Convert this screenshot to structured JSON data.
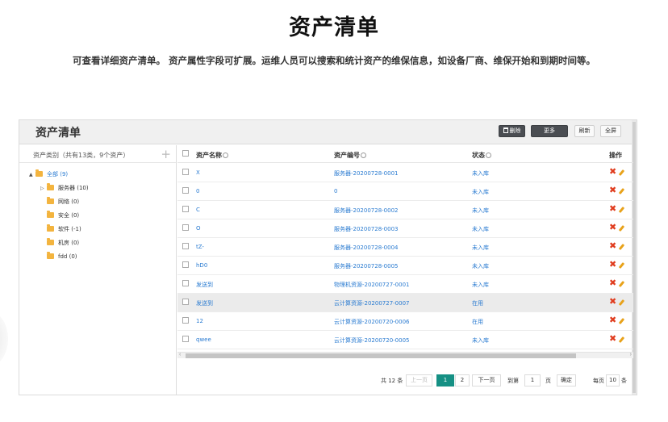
{
  "page": {
    "title": "资产清单",
    "subtitle": "可查看详细资产清单。 资产属性字段可扩展。运维人员可以搜索和统计资产的维保信息，如设备厂商、维保开始和到期时间等。"
  },
  "app": {
    "title": "资产清单",
    "toolbar": {
      "delete_label": "删除",
      "more_label": "更多",
      "refresh_label": "刷新",
      "fullscreen_label": "全屏"
    }
  },
  "sidebar": {
    "title": "资产类别（共有13类，9个资产）",
    "add_icon": "plus-icon",
    "root": {
      "label": "全部",
      "count": "(9)"
    },
    "items": [
      {
        "label": "服务器",
        "count": "(10)",
        "expandable": true
      },
      {
        "label": "网络",
        "count": "(0)"
      },
      {
        "label": "安全",
        "count": "(0)"
      },
      {
        "label": "软件",
        "count": "(-1)"
      },
      {
        "label": "机房",
        "count": "(0)"
      },
      {
        "label": "fdd",
        "count": "(0)"
      }
    ]
  },
  "table": {
    "headers": {
      "name": "资产名称",
      "code": "资产编号",
      "status": "状态",
      "actions": "操作"
    },
    "rows": [
      {
        "name": "X",
        "code": "服务器-20200728-0001",
        "status": "未入库"
      },
      {
        "name": "0",
        "code": "0",
        "status": "未入库"
      },
      {
        "name": "C",
        "code": "服务器-20200728-0002",
        "status": "未入库"
      },
      {
        "name": "O",
        "code": "服务器-20200728-0003",
        "status": "未入库"
      },
      {
        "name": "tZ-",
        "code": "服务器-20200728-0004",
        "status": "未入库"
      },
      {
        "name": "hD0",
        "code": "服务器-20200728-0005",
        "status": "未入库"
      },
      {
        "name": "发送到",
        "code": "物理机资源-20200727-0001",
        "status": "未入库"
      },
      {
        "name": "发送到",
        "code": "云计算资源-20200727-0007",
        "status": "在用",
        "highlighted": true
      },
      {
        "name": "12",
        "code": "云计算资源-20200720-0006",
        "status": "在用"
      },
      {
        "name": "qwee",
        "code": "云计算资源-20200720-0005",
        "status": "未入库"
      }
    ]
  },
  "pagination": {
    "total": "共 12 条",
    "prev": "上一页",
    "pages": [
      "1",
      "2"
    ],
    "current": "1",
    "next": "下一页",
    "goto_label": "到第",
    "goto_value": "1",
    "page_unit": "页",
    "confirm": "确定",
    "per_page_label": "每页",
    "per_page_value": "10",
    "per_page_unit": "条"
  },
  "colors": {
    "accent": "#159084",
    "link": "#2a7bd1",
    "delete": "#e03c1e",
    "folder": "#f3b43f"
  }
}
